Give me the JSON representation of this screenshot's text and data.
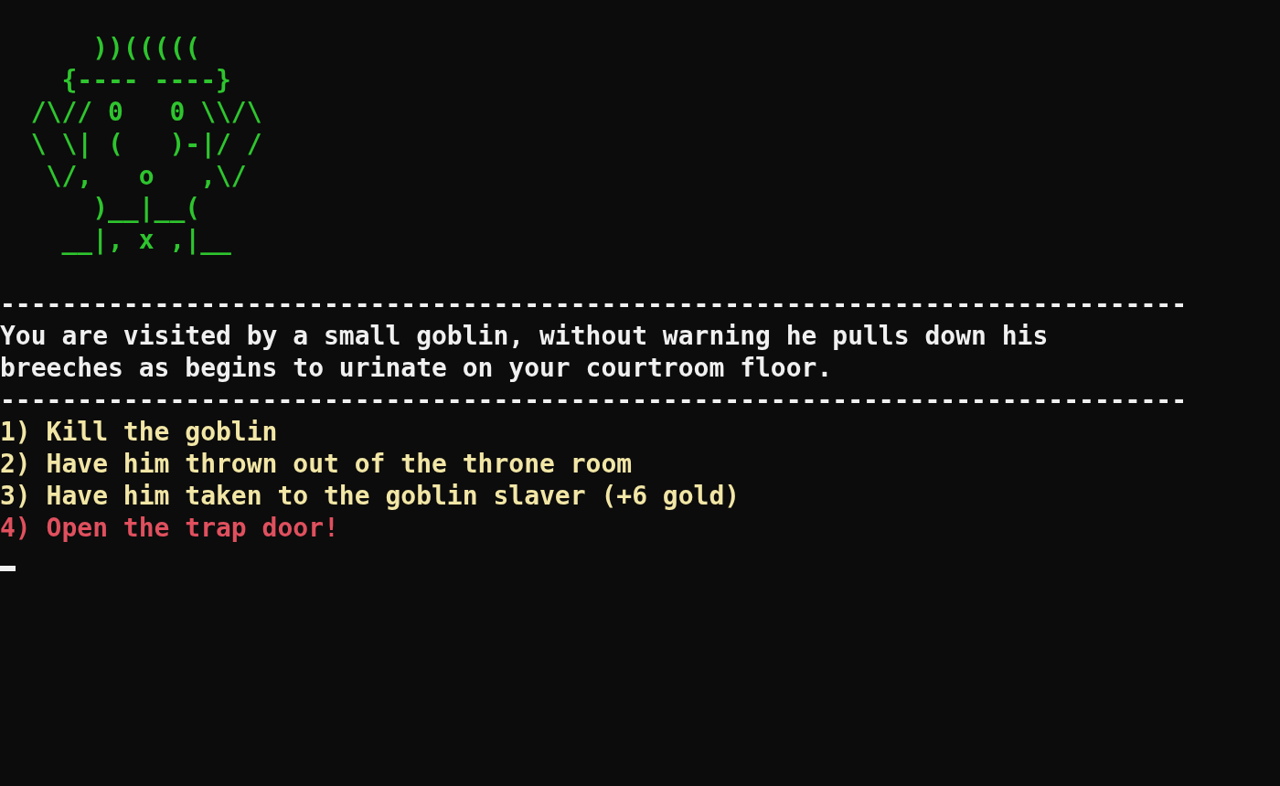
{
  "ascii_art": [
    "      ))(((((",
    "    {---- ----}",
    "  /\\// 0   0 \\\\/\\",
    "  \\ \\| (   )-|/ /",
    "   \\/,   o   ,\\/",
    "      )__|__(",
    "    __|, x ,|__"
  ],
  "divider_top": "-----------------------------------------------------------------------------",
  "message": [
    "You are visited by a small goblin, without warning he pulls down his",
    "breeches as begins to urinate on your courtroom floor."
  ],
  "divider_bottom": "-----------------------------------------------------------------------------",
  "options": [
    {
      "text": "1) Kill the goblin",
      "color": "#f2e6a6"
    },
    {
      "text": "2) Have him thrown out of the throne room",
      "color": "#f2e6a6"
    },
    {
      "text": "3) Have him taken to the goblin slaver (+6 gold)",
      "color": "#f2e6a6"
    },
    {
      "text": "4) Open the trap door!",
      "color": "#e0505e"
    }
  ]
}
